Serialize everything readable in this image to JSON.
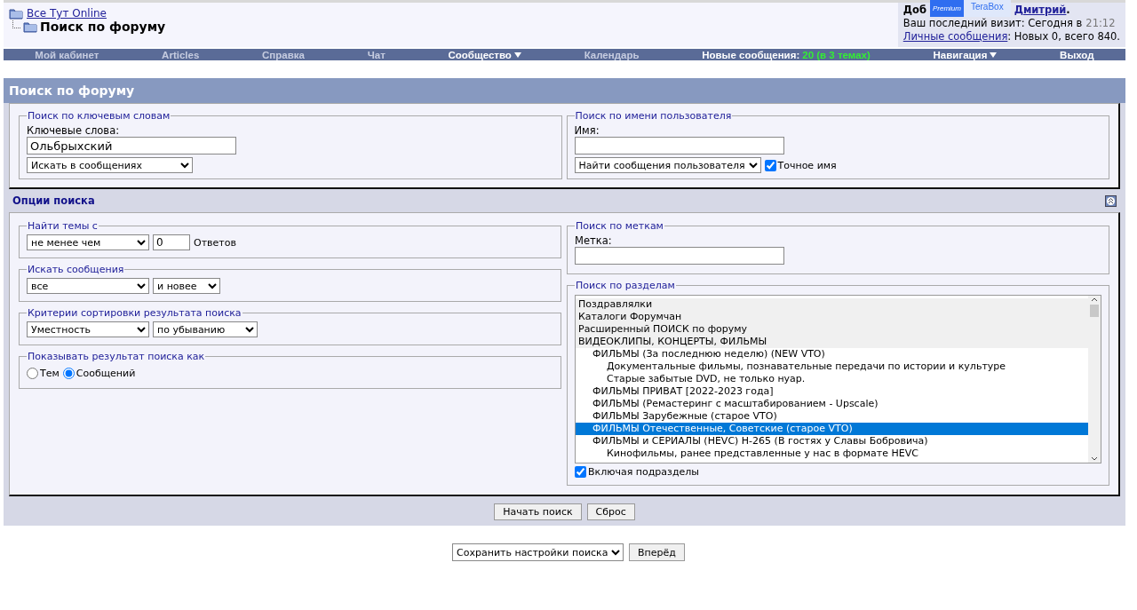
{
  "breadcrumb": {
    "root": "Все Тут Online",
    "current": "Поиск по форуму"
  },
  "welcome": {
    "greeting_start": "Доб",
    "user": "Дмитрий",
    "after": ".",
    "last_visit_label": "Ваш последний визит: Сегодня в",
    "last_visit_time": "21:12",
    "pm_link": "Личные сообщения",
    "pm_counts": ": Новых 0, всего 840."
  },
  "overlay": {
    "badge": "Premium",
    "title": "TeraBox"
  },
  "nav": [
    {
      "kind": "link",
      "label": "Мой кабинет",
      "highlighted": false,
      "dropdown": false
    },
    {
      "kind": "link",
      "label": "Articles",
      "highlighted": false,
      "dropdown": false
    },
    {
      "kind": "link",
      "label": "Справка",
      "highlighted": false,
      "dropdown": false
    },
    {
      "kind": "link",
      "label": "Чат",
      "highlighted": false,
      "dropdown": false
    },
    {
      "kind": "link",
      "label": "Сообщество",
      "highlighted": true,
      "dropdown": true
    },
    {
      "kind": "link",
      "label": "Календарь",
      "highlighted": false,
      "dropdown": false
    },
    {
      "kind": "counter",
      "label": "Новые сообщения:",
      "count": "20 (в 3 темах)",
      "highlighted": true,
      "dropdown": false
    },
    {
      "kind": "link",
      "label": "Навигация",
      "highlighted": true,
      "dropdown": true
    },
    {
      "kind": "link",
      "label": "Выход",
      "highlighted": true,
      "dropdown": false
    }
  ],
  "page_title": "Поиск по форуму",
  "keyword_search": {
    "legend": "Поиск по ключевым словам",
    "label": "Ключевые слова:",
    "value": "Ольбрыхский",
    "scope": "Искать в сообщениях"
  },
  "user_search": {
    "legend": "Поиск по имени пользователя",
    "label": "Имя:",
    "mode": "Найти сообщения пользователя",
    "exact_label": "Точное имя",
    "exact_checked": true
  },
  "options_title": "Опции поиска",
  "find_topics": {
    "legend": "Найти темы с",
    "comparison": "не менее чем",
    "count": "0",
    "unit": "Ответов"
  },
  "search_posts": {
    "legend": "Искать сообщения",
    "period": "все",
    "direction": "и новее"
  },
  "sort": {
    "legend": "Критерии сортировки результата поиска",
    "field": "Уместность",
    "order": "по убыванию"
  },
  "show_as": {
    "legend": "Показывать результат поиска как",
    "options": [
      {
        "label": "Тем",
        "selected": false
      },
      {
        "label": "Сообщений",
        "selected": true
      }
    ]
  },
  "tag_search": {
    "legend": "Поиск по меткам",
    "label": "Метка:"
  },
  "forum_search": {
    "legend": "Поиск по разделам",
    "include_sub_label": "Включая подразделы",
    "include_sub_checked": true,
    "forums": [
      {
        "kind": "category",
        "label": "Поздравлялки",
        "selected": false
      },
      {
        "kind": "category",
        "label": "Каталоги Форумчан",
        "selected": false
      },
      {
        "kind": "category",
        "label": "Расширенный ПОИСК по форуму",
        "selected": false
      },
      {
        "kind": "category",
        "label": "ВИДЕОКЛИПЫ, КОНЦЕРТЫ, ФИЛЬМЫ",
        "selected": false,
        "children": [
          {
            "kind": "forum",
            "label": "ФИЛЬМЫ (За последнюю неделю) (NEW VTO)",
            "selected": false,
            "children": [
              {
                "kind": "forum",
                "label": "Документальные фильмы, познавательные передачи по истории и культуре",
                "selected": false
              },
              {
                "kind": "forum",
                "label": "Старые забытые DVD, не только нуар.",
                "selected": false
              }
            ]
          },
          {
            "kind": "forum",
            "label": "ФИЛЬМЫ ПРИВАТ [2022-2023 года]",
            "selected": false
          },
          {
            "kind": "forum",
            "label": "ФИЛЬМЫ (Ремастеринг с масштабированием - Upscale)",
            "selected": false
          },
          {
            "kind": "forum",
            "label": "ФИЛЬМЫ Зарубежные (старое VTO)",
            "selected": false
          },
          {
            "kind": "forum",
            "label": "ФИЛЬМЫ Отечественные, Советские (старое VTO)",
            "selected": true
          },
          {
            "kind": "forum",
            "label": "ФИЛЬМЫ и СЕРИАЛЫ (HEVC) H-265 (В гостях у Славы Бобровича)",
            "selected": false,
            "children": [
              {
                "kind": "forum",
                "label": "Кинофильмы, ранее представленные у нас в формате HEVC",
                "selected": false
              }
            ]
          }
        ]
      }
    ]
  },
  "actions": [
    "Начать поиск",
    "Сброс"
  ],
  "bottom": {
    "preset": "Сохранить настройки поиска",
    "go": "Вперёд"
  }
}
